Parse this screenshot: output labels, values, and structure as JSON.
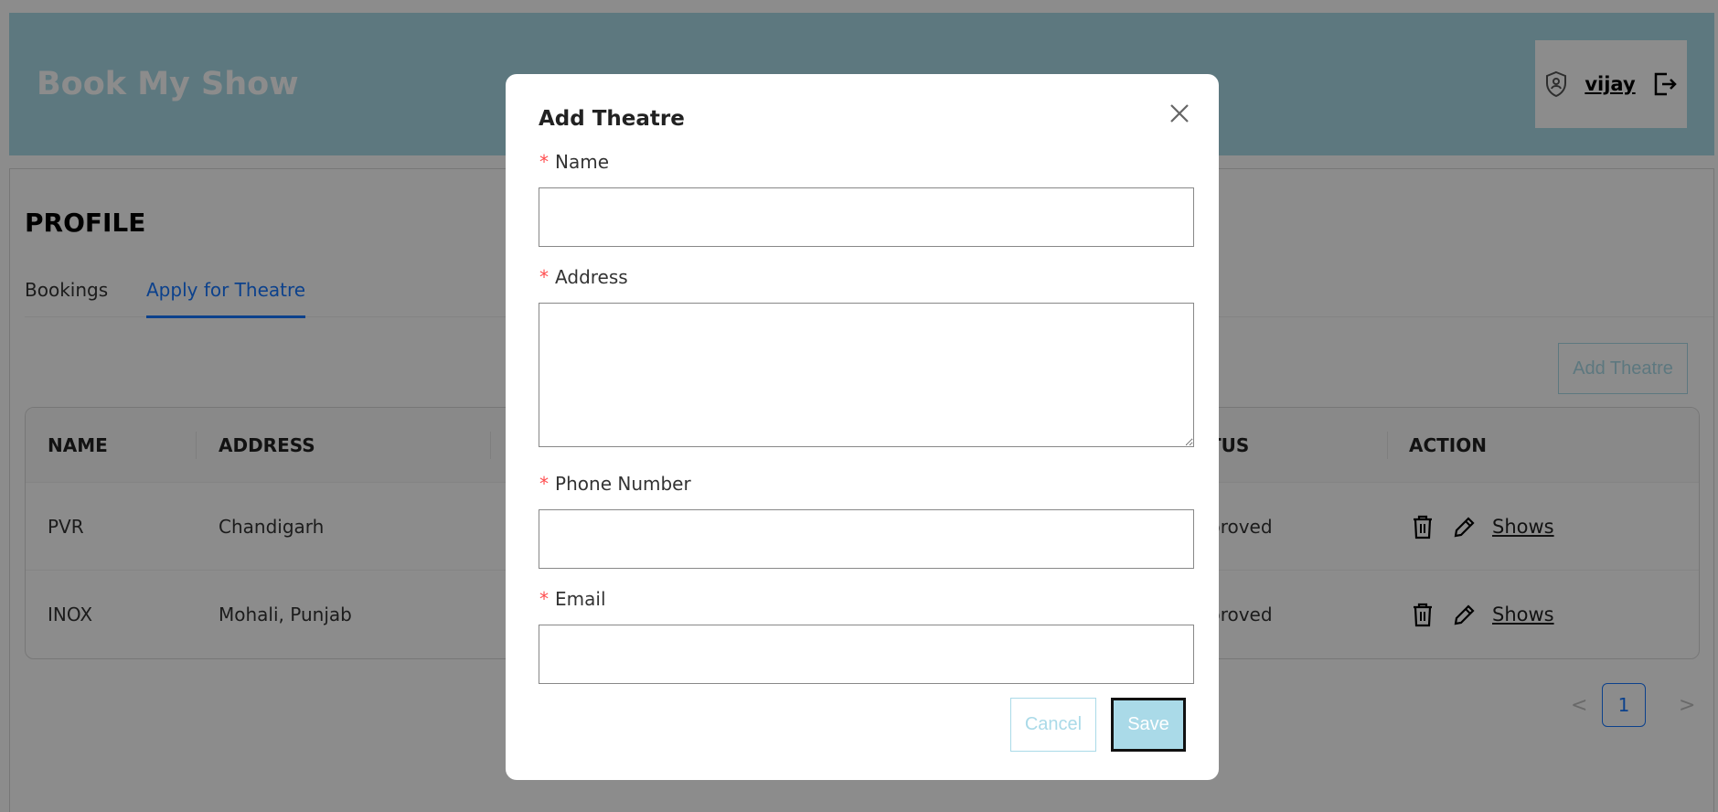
{
  "app": {
    "brand": "Book My Show",
    "user_name": "vijay"
  },
  "profile": {
    "title": "PROFILE",
    "tabs": [
      {
        "label": "Bookings",
        "active": false
      },
      {
        "label": "Apply for Theatre",
        "active": true
      }
    ],
    "add_theatre_button": "Add Theatre"
  },
  "table": {
    "columns": [
      "NAME",
      "ADDRESS",
      "TUS",
      "ACTION"
    ],
    "rows": [
      {
        "name": "PVR",
        "address": "Chandigarh",
        "status": "proved",
        "action_link": "Shows"
      },
      {
        "name": "INOX",
        "address": "Mohali, Punjab",
        "status": "proved",
        "action_link": "Shows"
      }
    ]
  },
  "pagination": {
    "prev": "<",
    "current": "1",
    "next": ">"
  },
  "modal": {
    "title": "Add Theatre",
    "required_mark": "*",
    "fields": {
      "name": {
        "label": "Name",
        "value": ""
      },
      "address": {
        "label": "Address",
        "value": ""
      },
      "phone": {
        "label": "Phone Number",
        "value": ""
      },
      "email": {
        "label": "Email",
        "value": ""
      }
    },
    "cancel_label": "Cancel",
    "save_label": "Save"
  },
  "colors": {
    "header_bg": "#aadae8",
    "accent_blue": "#1677ff",
    "required_red": "#ff4d4f",
    "mask": "rgba(0,0,0,0.45)"
  },
  "icons": [
    "shield-user-icon",
    "logout-icon",
    "delete-icon",
    "edit-icon",
    "close-icon"
  ]
}
